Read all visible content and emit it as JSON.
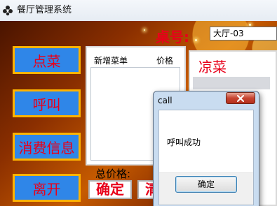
{
  "window": {
    "title": "餐厅管理系统",
    "icon": "flower-icon"
  },
  "header": {
    "table_label": "桌号:",
    "table_value": "大厅-03"
  },
  "sidebar": {
    "items": [
      {
        "label": "点菜"
      },
      {
        "label": "呼叫"
      },
      {
        "label": "消费信息"
      },
      {
        "label": "离开"
      }
    ]
  },
  "new_menu": {
    "col_name": "新增菜单",
    "col_price": "价格",
    "total_label": "总价格:"
  },
  "right_panel": {
    "title": "凉菜"
  },
  "buttons": {
    "confirm": "确定",
    "clear": "清空"
  },
  "dialog": {
    "title": "call",
    "message": "呼叫成功",
    "ok_label": "确定",
    "close_icon": "close-icon"
  },
  "colors": {
    "accent_red": "#e8001a",
    "button_blue": "#2f86e8",
    "button_border": "#ffb300"
  }
}
